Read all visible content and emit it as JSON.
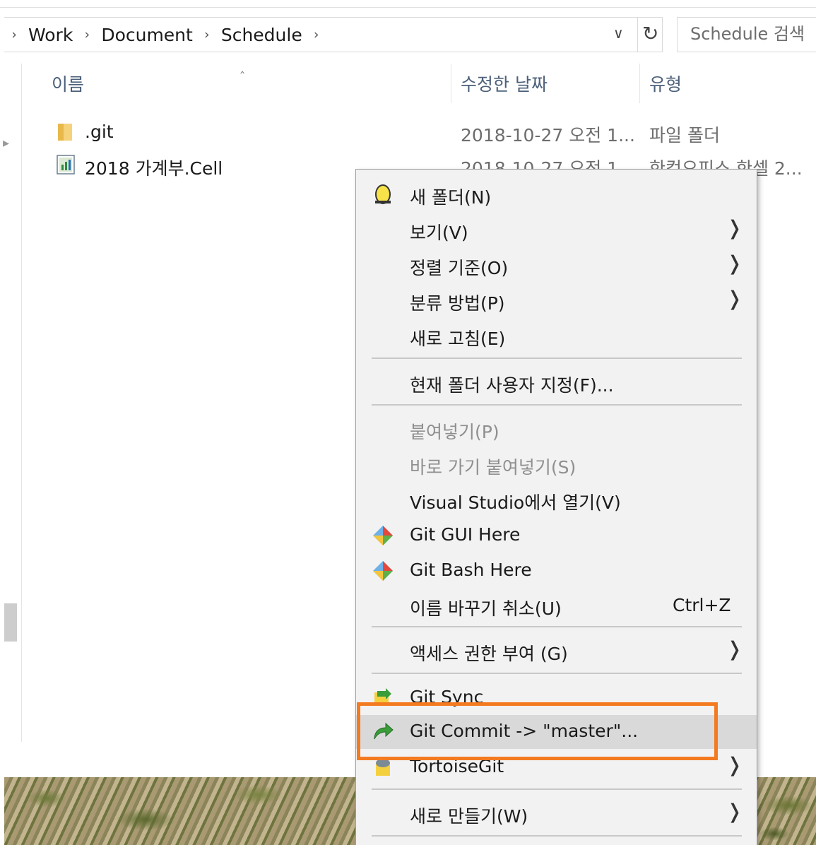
{
  "breadcrumb": {
    "items": [
      "Work",
      "Document",
      "Schedule"
    ]
  },
  "search": {
    "placeholder": "Schedule 검색"
  },
  "columns": {
    "name": "이름",
    "modified": "수정한 날짜",
    "type": "유형"
  },
  "files": [
    {
      "name": ".git",
      "modified": "2018-10-27 오전 1...",
      "type": "파일 폴더",
      "icon": "folder-icon"
    },
    {
      "name": "2018 가계부.Cell",
      "modified": "2018-10-27 오전 1...",
      "type": "한컴오피스 한셀 2...",
      "icon": "spreadsheet-icon"
    }
  ],
  "context_menu": {
    "items": [
      {
        "label": "새 폴더(N)",
        "icon": "new-folder-icon"
      },
      {
        "label": "보기(V)",
        "submenu": true
      },
      {
        "label": "정렬 기준(O)",
        "submenu": true
      },
      {
        "label": "분류 방법(P)",
        "submenu": true
      },
      {
        "label": "새로 고침(E)"
      },
      {
        "label": "현재 폴더 사용자 지정(F)..."
      },
      {
        "label": "붙여넣기(P)",
        "disabled": true
      },
      {
        "label": "바로 가기 붙여넣기(S)",
        "disabled": true
      },
      {
        "label": "Visual Studio에서 열기(V)"
      },
      {
        "label": "Git GUI Here",
        "icon": "git-gui-icon"
      },
      {
        "label": "Git Bash Here",
        "icon": "git-bash-icon"
      },
      {
        "label": "이름 바꾸기 취소(U)",
        "shortcut": "Ctrl+Z"
      },
      {
        "label": "액세스 권한 부여 (G)",
        "submenu": true
      },
      {
        "label": "Git Sync",
        "icon": "git-sync-icon"
      },
      {
        "label": "Git Commit -> \"master\"...",
        "icon": "git-commit-icon",
        "highlighted": true
      },
      {
        "label": "TortoiseGit",
        "icon": "tortoisegit-icon",
        "submenu": true
      },
      {
        "label": "새로 만들기(W)",
        "submenu": true
      }
    ]
  },
  "colors": {
    "highlight_box": "#f47a20",
    "menu_bg": "#f2f2f2",
    "hover_bg": "#d9d9d9"
  }
}
